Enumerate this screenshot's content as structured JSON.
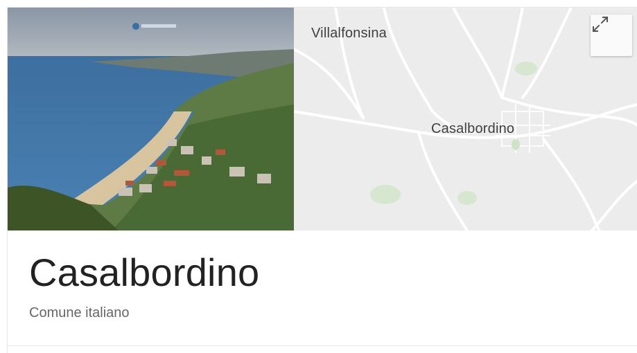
{
  "map": {
    "labels": {
      "villalfonsina": "Villalfonsina",
      "casalbordino": "Casalbordino"
    },
    "expand_icon": "expand-arrows-icon"
  },
  "place": {
    "name": "Casalbordino",
    "description": "Comune italiano"
  },
  "colors": {
    "sea": "#3f73a8",
    "map_bg": "#ececec",
    "road": "#ffffff",
    "title": "#222222",
    "subtitle": "#666666"
  }
}
